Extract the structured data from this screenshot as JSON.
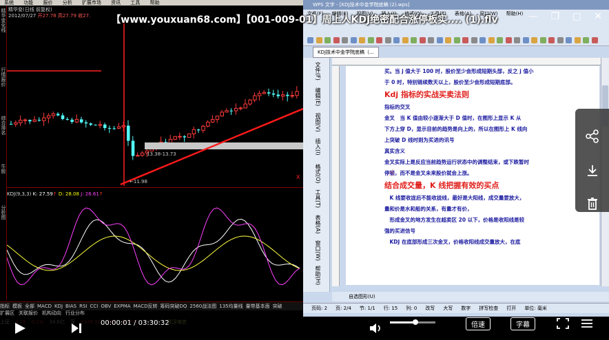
{
  "video": {
    "title": "【www.youxuan68.com】【001-009-01】周上人KDJ绝密配合涨停板实.... (1).flv",
    "time_current": "00:00:01",
    "time_sep": "/",
    "time_total": "03:30:32",
    "speed_label": "倍速",
    "subtitle_label": "字幕",
    "controls": {
      "minimize": "—",
      "restore": "❐",
      "pin": "▢",
      "close": "✕"
    }
  },
  "stock": {
    "menu": [
      "系统",
      "功能",
      "报价",
      "分析",
      "扩展市场",
      "资讯",
      "工具",
      "帮助"
    ],
    "sidebar": [
      "精华变化线",
      "行情报价",
      "综合排名",
      "牛股",
      "分析图"
    ],
    "info_line1": "精华变(日线 前复权)",
    "info_line2": "2012/07/27",
    "info_price": "开27.78 高27.79 收27.",
    "label_range": "13.38-13.73",
    "label_low": "←11.98",
    "kdj_label": "KDJ(9,3,3)",
    "kdj_k": "K: 27.59",
    "kdj_d": "D: 28.08",
    "kdj_j": "J: 26.61",
    "kdj_k_arrow": "↑",
    "kdj_j_arrow": "↑",
    "x_marker": "X",
    "bottom_tabs": [
      "指标",
      "模板",
      "全部",
      "MACD",
      "KDJ",
      "BIAS",
      "RSI",
      "CCI",
      "OBV",
      "EXPMA",
      "MACD反转",
      "筹码突破DQ",
      "2560战法图",
      "135均量线",
      "量带基本面",
      "突破"
    ],
    "bottom_tabs2": [
      "扩展区",
      "关联报价",
      "机构动向",
      "行业分布"
    ],
    "status": [
      "上证",
      "2.76",
      "0.1%",
      "34.6亿",
      "深",
      "2349.11",
      "1.62",
      "0.07%",
      "330.5亿",
      "武汉电信"
    ]
  },
  "wps": {
    "window_title": "WPS 文字 - [KDJ技术中金学院底稿 (2).wps]",
    "menu": [
      "文件(F)",
      "编辑(E)",
      "视图(V)",
      "插入(I)",
      "格式(O)",
      "工具(T)",
      "表格(A)",
      "窗口(W)",
      "帮助(H)"
    ],
    "doc_tab": "KDJ技术中金学院底稿（...",
    "side_tabs": [
      "文件(F)",
      "编辑(E)",
      "视图(V)",
      "插入(I)",
      "格式(O)",
      "工具(T)",
      "表格(A)",
      "窗口(W)",
      "帮助(H)"
    ],
    "doc_lines": [
      {
        "text": "买。当 j 值大于 100 时，股价至少会形成短期头部，反之 j 值小",
        "h": false
      },
      {
        "text": "于 0 时，特别链续数天以上，股价至少会形成短期底部。",
        "h": false
      },
      {
        "text": "Kdj 指标的实战买卖法则",
        "h": true
      },
      {
        "text": "指标的交叉",
        "h": false
      },
      {
        "text": "金叉　当 K 值由较小逐渐大于 D 值时，在图形上显示 K 从",
        "h": false
      },
      {
        "text": "下方上穿 D，显示目前的趋势是向上的，所以在图形上 K 线向",
        "h": false
      },
      {
        "text": "上突破 D 线时则为买进的讯号",
        "h": false
      },
      {
        "text": "真实含义",
        "h": false
      },
      {
        "text": "金叉实际上是反应当前趋势运行状态中的调整结束，或下跌暂时",
        "h": false
      },
      {
        "text": "停顿，而不是金叉未来股价就会上涨。",
        "h": false
      },
      {
        "text": "结合成交量，K 线把握有效的买点",
        "h": true
      },
      {
        "text": "　K 线要收拢后不能收拢线，最好是大阳线，成交量要放大，",
        "h": false
      },
      {
        "text": "量和价是水和船的关系，有量才有价，",
        "h": false
      },
      {
        "text": "　形成金叉的地方发生在超卖区 20 以下，价格是收阳线是较",
        "h": false
      },
      {
        "text": "强的买进信号",
        "h": false
      },
      {
        "text": "　KDJ 在底部形成三次金叉，价格收阳线成交量放大，在底",
        "h": false
      }
    ],
    "draw_label": "自选图形(U)",
    "status": [
      "页码: 2",
      "页: 2/4",
      "节: 1/1",
      "行: 15",
      "列: 0",
      "改写",
      "大写",
      "数字",
      "拼写检查",
      "打开",
      "单位: 毫米"
    ]
  },
  "colors": {
    "up": "#ff3b3b",
    "down": "#54ffff",
    "trend": "#ff1a1a",
    "doc_text": "#1a1aa0",
    "doc_head": "#e0201c"
  }
}
